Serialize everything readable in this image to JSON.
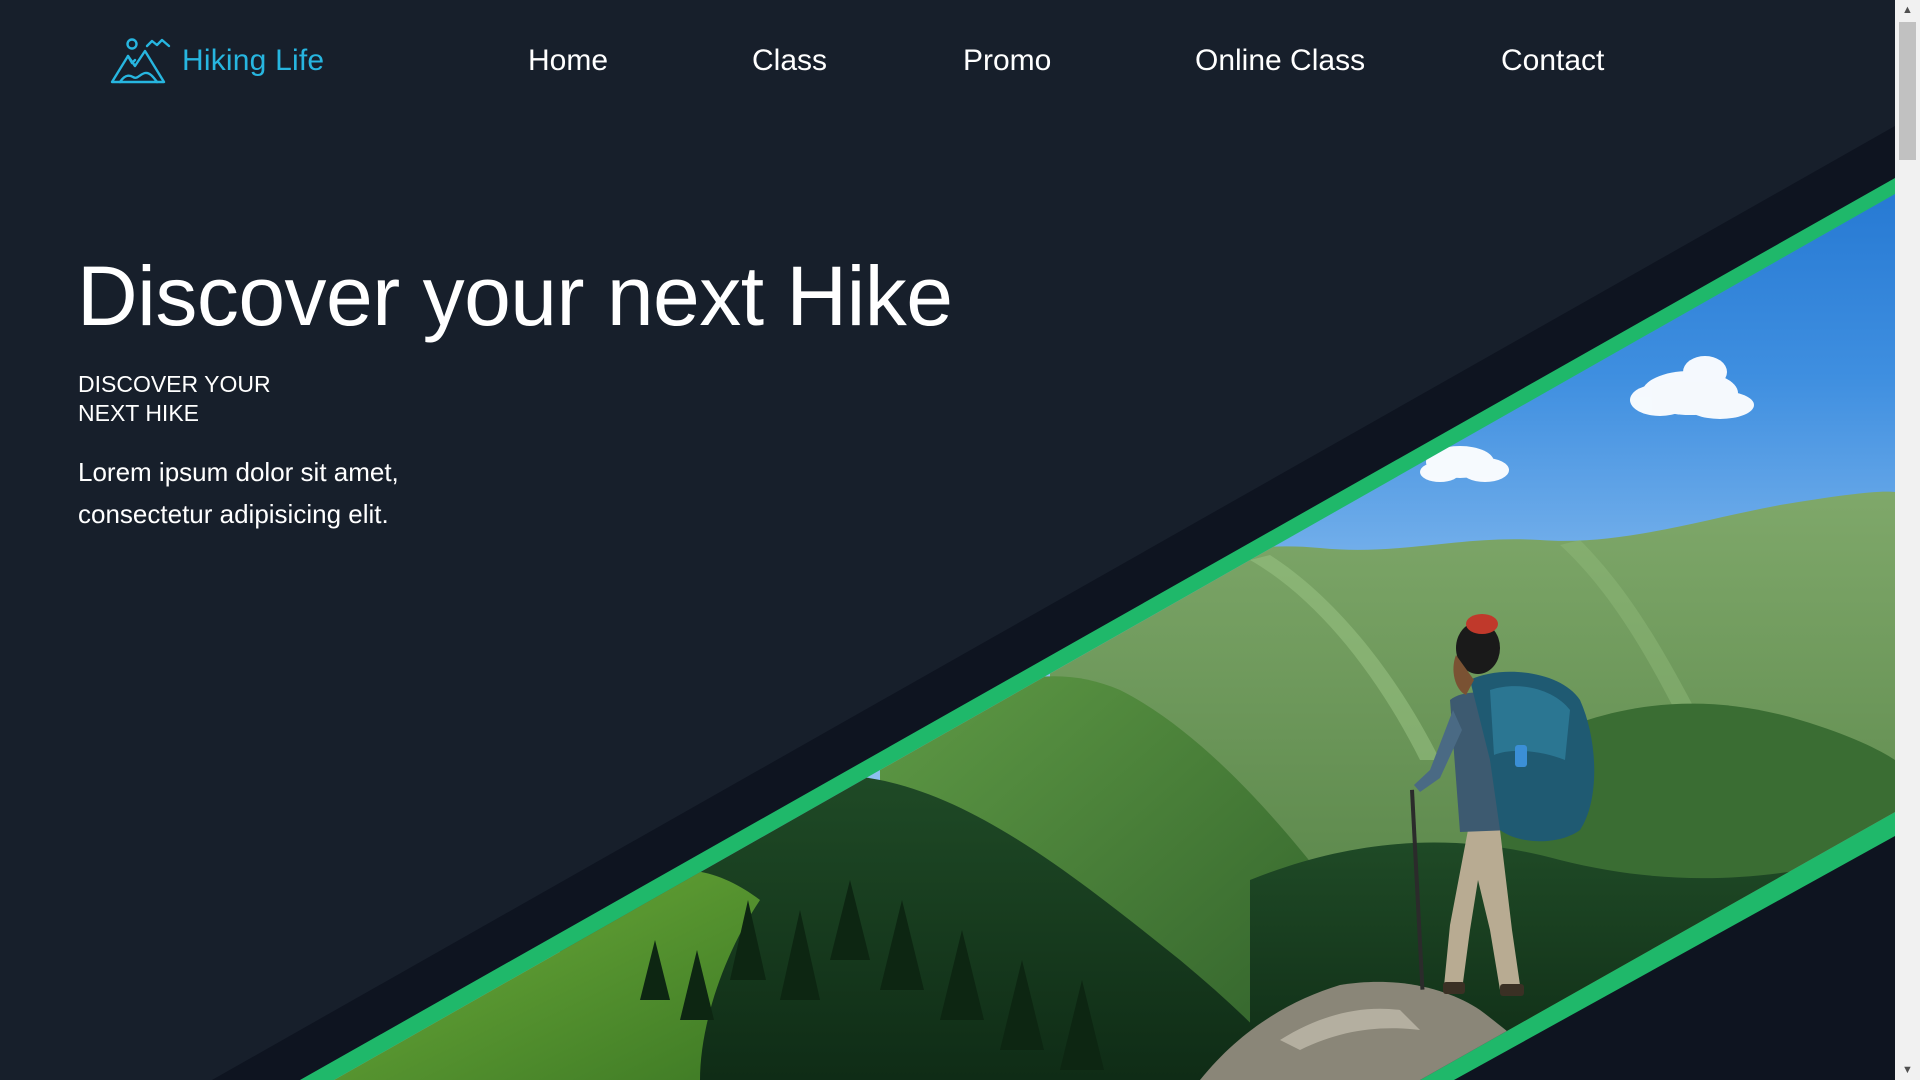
{
  "brand": {
    "name": "Hiking Life",
    "icon": "mountain-logo-icon",
    "color": "#27b6e0"
  },
  "nav": {
    "items": [
      {
        "label": "Home"
      },
      {
        "label": "Class"
      },
      {
        "label": "Promo"
      },
      {
        "label": "Online Class"
      },
      {
        "label": "Contact"
      }
    ]
  },
  "hero": {
    "title": "Discover your next Hike",
    "subtitle": "DISCOVER YOUR NEXT HIKE",
    "description": "Lorem ipsum dolor sit amet, consectetur adipisicing elit."
  },
  "theme": {
    "background": "#171f2b",
    "band_dark": "#0e1420",
    "accent_green": "#1fb86a",
    "text": "#ffffff"
  },
  "scrollbar": {
    "up_icon": "scroll-up-arrow-icon",
    "down_icon": "scroll-down-arrow-icon"
  }
}
